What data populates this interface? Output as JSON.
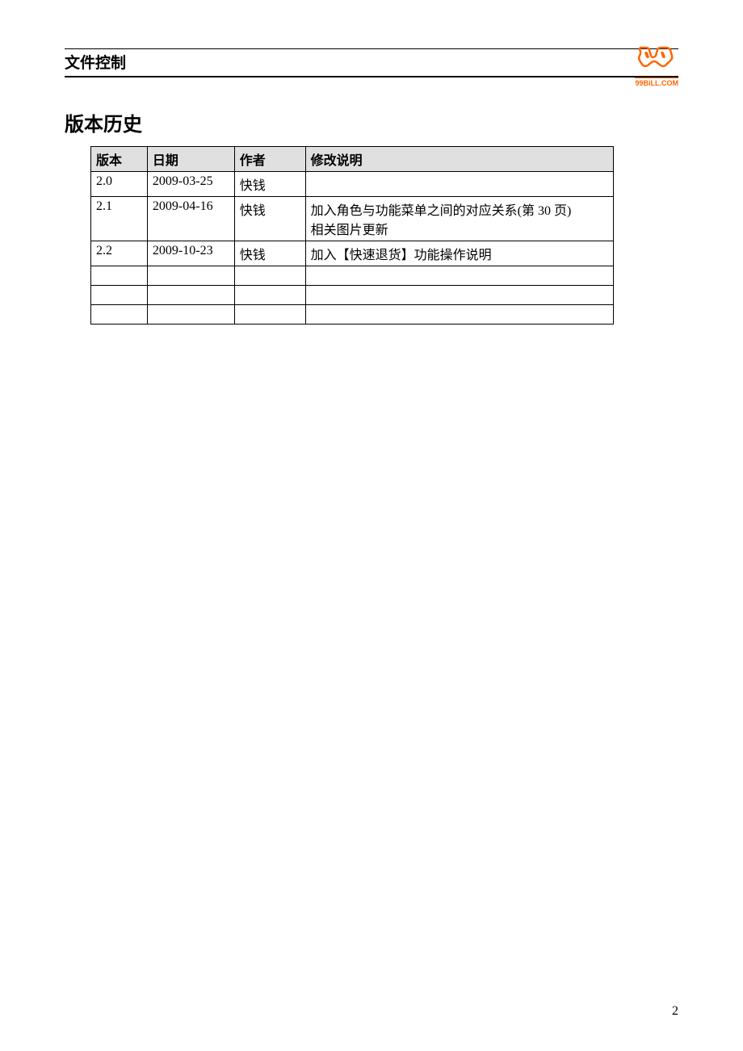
{
  "logo": {
    "url_text": "99BiLL.COM"
  },
  "section_title": "文件控制",
  "sub_heading": "版本历史",
  "table": {
    "headers": {
      "version": "版本",
      "date": "日期",
      "author": "作者",
      "description": "修改说明"
    },
    "rows": [
      {
        "version": "2.0",
        "date": "2009-03-25",
        "author": "快钱",
        "description": ""
      },
      {
        "version": "2.1",
        "date": "2009-04-16",
        "author": "快钱",
        "description": "加入角色与功能菜单之间的对应关系(第 30 页)\n相关图片更新"
      },
      {
        "version": "2.2",
        "date": "2009-10-23",
        "author": "快钱",
        "description": "加入【快速退货】功能操作说明"
      }
    ]
  },
  "page_number": "2"
}
